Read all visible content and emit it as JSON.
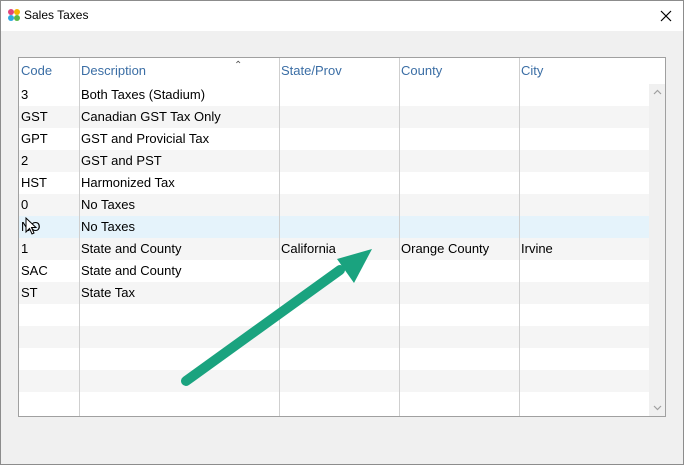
{
  "window": {
    "title": "Sales Taxes"
  },
  "grid": {
    "columns": [
      "Code",
      "Description",
      "State/Prov",
      "County",
      "City"
    ],
    "sorted_column": "Description",
    "rows": [
      [
        "3",
        "Both Taxes (Stadium)",
        "",
        "",
        ""
      ],
      [
        "GST",
        "Canadian GST Tax Only",
        "",
        "",
        ""
      ],
      [
        "GPT",
        "GST and Provicial Tax",
        "",
        "",
        ""
      ],
      [
        "2",
        "GST and PST",
        "",
        "",
        ""
      ],
      [
        "HST",
        "Harmonized Tax",
        "",
        "",
        ""
      ],
      [
        "0",
        "No Taxes",
        "",
        "",
        ""
      ],
      [
        "NO",
        "No Taxes",
        "",
        "",
        ""
      ],
      [
        "1",
        "State and County",
        "California",
        "Orange County",
        "Irvine"
      ],
      [
        "SAC",
        "State and County",
        "",
        "",
        ""
      ],
      [
        "ST",
        "State Tax",
        "",
        "",
        ""
      ],
      [
        "",
        "",
        "",
        "",
        ""
      ],
      [
        "",
        "",
        "",
        "",
        ""
      ],
      [
        "",
        "",
        "",
        "",
        ""
      ],
      [
        "",
        "",
        "",
        "",
        ""
      ],
      [
        "",
        "",
        "",
        "",
        ""
      ]
    ],
    "hover_row_index": 6
  },
  "annotation": {
    "arrow_color": "#1aa37f"
  },
  "icons": [
    "app-logo-icon",
    "close-icon",
    "sort-ascending-icon",
    "scroll-up-icon",
    "scroll-down-icon",
    "mouse-cursor-icon"
  ]
}
